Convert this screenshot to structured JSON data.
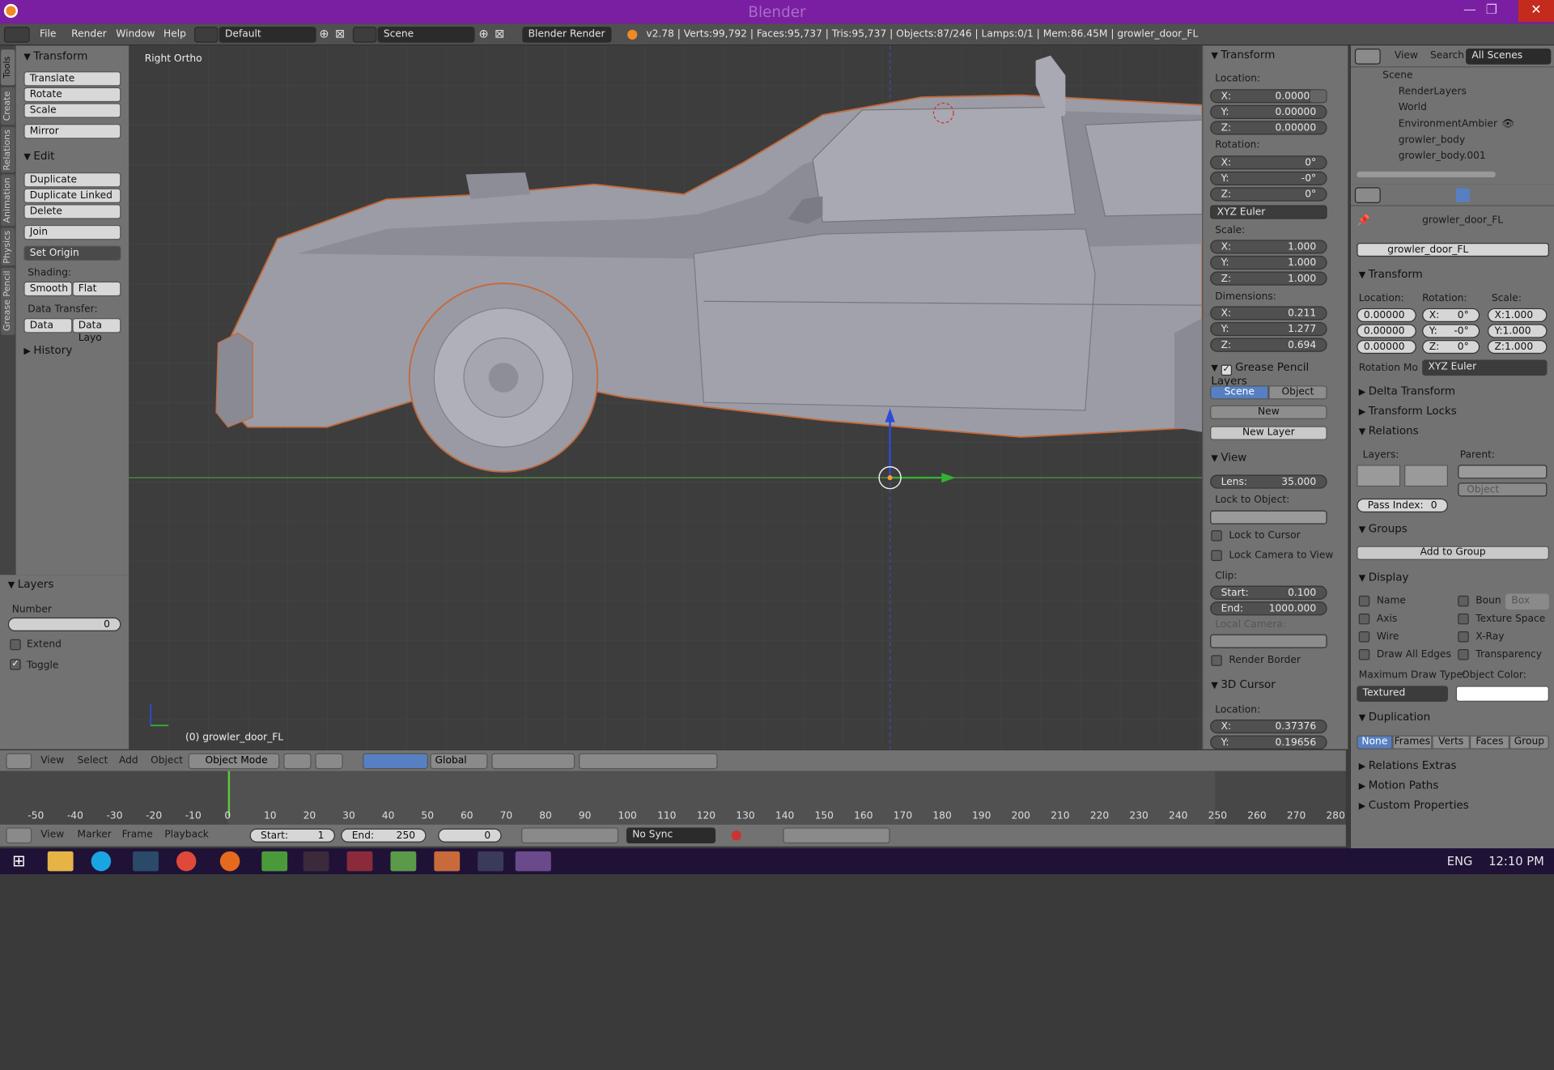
{
  "titlebar": {
    "title": "Blender"
  },
  "menubar": {
    "items": [
      "File",
      "Render",
      "Window",
      "Help"
    ],
    "layout": "Default",
    "scene": "Scene",
    "engine": "Blender Render",
    "stats": "v2.78 | Verts:99,792 | Faces:95,737 | Tris:95,737 | Objects:87/246 | Lamps:0/1 | Mem:86.45M | growler_door_FL"
  },
  "vtabs": [
    "Tools",
    "Create",
    "Relations",
    "Animation",
    "Physics",
    "Grease Pencil"
  ],
  "toolshelf": {
    "transform_header": "Transform",
    "translate": "Translate",
    "rotate": "Rotate",
    "scale": "Scale",
    "mirror": "Mirror",
    "edit_header": "Edit",
    "duplicate": "Duplicate",
    "duplicate_linked": "Duplicate Linked",
    "delete": "Delete",
    "join": "Join",
    "set_origin": "Set Origin",
    "shading_label": "Shading:",
    "smooth": "Smooth",
    "flat": "Flat",
    "data_transfer_label": "Data Transfer:",
    "data": "Data",
    "data_layo": "Data Layo",
    "history": "History"
  },
  "layers_panel": {
    "header": "Layers",
    "number_label": "Number",
    "number": "0",
    "extend": "Extend",
    "toggle": "Toggle"
  },
  "viewport": {
    "view_name": "Right Ortho",
    "object_label": "(0) growler_door_FL"
  },
  "npanel": {
    "transform": "Transform",
    "location": "Location:",
    "loc": [
      {
        "k": "X:",
        "v": "0.00000"
      },
      {
        "k": "Y:",
        "v": "0.00000"
      },
      {
        "k": "Z:",
        "v": "0.00000"
      }
    ],
    "rotation": "Rotation:",
    "rot": [
      {
        "k": "X:",
        "v": "0°"
      },
      {
        "k": "Y:",
        "v": "-0°"
      },
      {
        "k": "Z:",
        "v": "0°"
      }
    ],
    "euler": "XYZ Euler",
    "scale": "Scale:",
    "scl": [
      {
        "k": "X:",
        "v": "1.000"
      },
      {
        "k": "Y:",
        "v": "1.000"
      },
      {
        "k": "Z:",
        "v": "1.000"
      }
    ],
    "dimensions": "Dimensions:",
    "dim": [
      {
        "k": "X:",
        "v": "0.211"
      },
      {
        "k": "Y:",
        "v": "1.277"
      },
      {
        "k": "Z:",
        "v": "0.694"
      }
    ],
    "gp_layers": "Grease Pencil Layers",
    "scene_tab": "Scene",
    "object_tab": "Object",
    "new": "New",
    "new_layer": "New Layer",
    "view": "View",
    "lens_k": "Lens:",
    "lens_v": "35.000",
    "lock_to_object": "Lock to Object:",
    "lock_to_cursor": "Lock to Cursor",
    "lock_camera": "Lock Camera to View",
    "clip": "Clip:",
    "start_k": "Start:",
    "start_v": "0.100",
    "end_k": "End:",
    "end_v": "1000.000",
    "local_camera": "Local Camera:",
    "render_border": "Render Border",
    "cursor3d": "3D Cursor",
    "cloc": "Location:",
    "cx_k": "X:",
    "cx_v": "0.37376",
    "cy_k": "Y:",
    "cy_v": "0.19656"
  },
  "outliner": {
    "view": "View",
    "search": "Search",
    "all_scenes": "All Scenes",
    "items": [
      "Scene",
      "RenderLayers",
      "World",
      "EnvironmentAmbientLi",
      "growler_body",
      "growler_body.001"
    ]
  },
  "props": {
    "object_path": "growler_door_FL",
    "object_name": "growler_door_FL",
    "transform": "Transform",
    "location": "Location:",
    "rotation": "Rotation:",
    "scale": "Scale:",
    "loc": [
      "0.00000",
      "0.00000",
      "0.00000"
    ],
    "rot": [
      {
        "k": "X:",
        "v": "0°"
      },
      {
        "k": "Y:",
        "v": "-0°"
      },
      {
        "k": "Z:",
        "v": "0°"
      }
    ],
    "scl": [
      "X:1.000",
      "Y:1.000",
      "Z:1.000"
    ],
    "rotation_mode_label": "Rotation Mo",
    "rotation_mode": "XYZ Euler",
    "delta_transform": "Delta Transform",
    "transform_locks": "Transform Locks",
    "relations": "Relations",
    "layers": "Layers:",
    "parent": "Parent:",
    "object_placeholder": "Object",
    "pass_index_k": "Pass Index:",
    "pass_index_v": "0",
    "groups": "Groups",
    "add_to_group": "Add to Group",
    "display": "Display",
    "name": "Name",
    "bounds": "Boun",
    "box": "Box",
    "axis": "Axis",
    "texture_space": "Texture Space",
    "wire": "Wire",
    "xray": "X-Ray",
    "draw_all_edges": "Draw All Edges",
    "transparency": "Transparency",
    "max_draw_type": "Maximum Draw Type:",
    "object_color": "Object Color:",
    "textured": "Textured",
    "duplication": "Duplication",
    "dup_opts": [
      "None",
      "Frames",
      "Verts",
      "Faces",
      "Group"
    ],
    "relations_extras": "Relations Extras",
    "motion_paths": "Motion Paths",
    "custom_properties": "Custom Properties"
  },
  "vp_header": {
    "view": "View",
    "select": "Select",
    "add": "Add",
    "object": "Object",
    "mode": "Object Mode",
    "orientation": "Global"
  },
  "timeline": {
    "ticks": [
      "-50",
      "-40",
      "-30",
      "-20",
      "-10",
      "0",
      "10",
      "20",
      "30",
      "40",
      "50",
      "60",
      "70",
      "80",
      "90",
      "100",
      "110",
      "120",
      "130",
      "140",
      "150",
      "160",
      "170",
      "180",
      "190",
      "200",
      "210",
      "220",
      "230",
      "240",
      "250",
      "260",
      "270",
      "280"
    ],
    "current_frame": 0
  },
  "tl_header": {
    "view": "View",
    "marker": "Marker",
    "frame": "Frame",
    "playback": "Playback",
    "start_k": "Start:",
    "start_v": "1",
    "end_k": "End:",
    "end_v": "250",
    "cur": "0",
    "sync": "No Sync"
  },
  "taskbar": {
    "lang": "ENG",
    "time": "12:10 PM"
  }
}
